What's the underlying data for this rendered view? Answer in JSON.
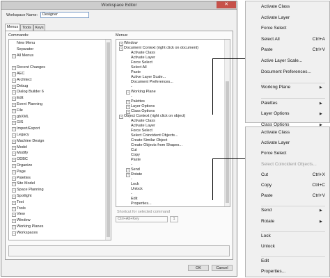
{
  "dialog": {
    "title": "Workspace Editor",
    "close_glyph": "✕",
    "workspace_name_label": "Workspace Name:",
    "workspace_name_value": "Designer",
    "tabs": [
      "Menus",
      "Tools",
      "Keys"
    ],
    "commands_label": "Commands:",
    "menus_label": "Menus:",
    "commands": [
      {
        "label": "New Menu",
        "exp": false
      },
      {
        "label": "Separator",
        "exp": false
      },
      {
        "label": "All Menus",
        "exp": true
      },
      {
        "label": "",
        "exp": false
      },
      {
        "label": "Recent Changes",
        "exp": true
      },
      {
        "label": "AEC",
        "exp": true
      },
      {
        "label": "Architect",
        "exp": true
      },
      {
        "label": "Debug",
        "exp": true
      },
      {
        "label": "Dialog Builder 6",
        "exp": true
      },
      {
        "label": "Edit",
        "exp": true
      },
      {
        "label": "Event Planning",
        "exp": true
      },
      {
        "label": "File",
        "exp": true
      },
      {
        "label": "gbXML",
        "exp": true
      },
      {
        "label": "GIS",
        "exp": true
      },
      {
        "label": "Import/Export",
        "exp": true
      },
      {
        "label": "Legacy",
        "exp": true
      },
      {
        "label": "Machine Design",
        "exp": true
      },
      {
        "label": "Model",
        "exp": true
      },
      {
        "label": "Modify",
        "exp": true
      },
      {
        "label": "ODBC",
        "exp": true
      },
      {
        "label": "Organize",
        "exp": true
      },
      {
        "label": "Page",
        "exp": true
      },
      {
        "label": "Palettes",
        "exp": true
      },
      {
        "label": "Site Model",
        "exp": true
      },
      {
        "label": "Space Planning",
        "exp": true
      },
      {
        "label": "Spotlight",
        "exp": true
      },
      {
        "label": "Text",
        "exp": true
      },
      {
        "label": "Tools",
        "exp": true
      },
      {
        "label": "View",
        "exp": true
      },
      {
        "label": "Window",
        "exp": true
      },
      {
        "label": "Working Planes",
        "exp": true
      },
      {
        "label": "Workspaces",
        "exp": true
      }
    ],
    "menus_tree": [
      {
        "label": "Window",
        "level": 0,
        "exp": true
      },
      {
        "label": "Document Context (right click on document)",
        "level": 0,
        "exp": true
      },
      {
        "label": "Activate Class",
        "level": 1,
        "exp": false
      },
      {
        "label": "Activate Layer",
        "level": 1,
        "exp": false
      },
      {
        "label": "Force Select",
        "level": 1,
        "exp": false
      },
      {
        "label": "Select All",
        "level": 1,
        "exp": false
      },
      {
        "label": "Paste",
        "level": 1,
        "exp": false
      },
      {
        "label": "Active Layer Scale...",
        "level": 1,
        "exp": false
      },
      {
        "label": "Document Preferences...",
        "level": 1,
        "exp": false
      },
      {
        "label": "-",
        "level": 1,
        "exp": false
      },
      {
        "label": "Working Plane",
        "level": 1,
        "exp": true
      },
      {
        "label": "-",
        "level": 1,
        "exp": false
      },
      {
        "label": "Palettes",
        "level": 1,
        "exp": true
      },
      {
        "label": "Layer Options",
        "level": 1,
        "exp": true
      },
      {
        "label": "Class Options",
        "level": 1,
        "exp": true
      },
      {
        "label": "Object Context (right click on object)",
        "level": 0,
        "exp": true
      },
      {
        "label": "Activate Class",
        "level": 1,
        "exp": false
      },
      {
        "label": "Activate Layer",
        "level": 1,
        "exp": false
      },
      {
        "label": "Force Select",
        "level": 1,
        "exp": false
      },
      {
        "label": "Select Coincident Objects...",
        "level": 1,
        "exp": false
      },
      {
        "label": "Create Similar Object",
        "level": 1,
        "exp": false
      },
      {
        "label": "Create Objects from Shapes...",
        "level": 1,
        "exp": false
      },
      {
        "label": "Cut",
        "level": 1,
        "exp": false
      },
      {
        "label": "Copy",
        "level": 1,
        "exp": false
      },
      {
        "label": "Paste",
        "level": 1,
        "exp": false
      },
      {
        "label": "-",
        "level": 1,
        "exp": false
      },
      {
        "label": "Send",
        "level": 1,
        "exp": true
      },
      {
        "label": "Rotate",
        "level": 1,
        "exp": true
      },
      {
        "label": "-",
        "level": 1,
        "exp": false
      },
      {
        "label": "Lock",
        "level": 1,
        "exp": false
      },
      {
        "label": "Unlock",
        "level": 1,
        "exp": false
      },
      {
        "label": "-",
        "level": 1,
        "exp": false
      },
      {
        "label": "Edit",
        "level": 1,
        "exp": false
      },
      {
        "label": "Properties...",
        "level": 1,
        "exp": false
      }
    ],
    "shortcut_label": "Shortcut for selected command",
    "shortcut_modifier": "Ctrl+Alt+Key",
    "shortcut_key": "1",
    "ok_label": "OK",
    "cancel_label": "Cancel"
  },
  "menu_document": [
    {
      "label": "Activate Class",
      "shortcut": "",
      "submenu": false
    },
    {
      "label": "Activate Layer",
      "shortcut": "",
      "submenu": false
    },
    {
      "label": "Force Select",
      "shortcut": "",
      "submenu": false
    },
    {
      "label": "Select All",
      "shortcut": "Ctrl+A",
      "submenu": false
    },
    {
      "label": "Paste",
      "shortcut": "Ctrl+V",
      "submenu": false
    },
    {
      "label": "Active Layer Scale...",
      "shortcut": "",
      "submenu": false
    },
    {
      "label": "Document Preferences...",
      "shortcut": "",
      "submenu": false
    },
    {
      "label": "-",
      "shortcut": "",
      "submenu": false
    },
    {
      "label": "Working Plane",
      "shortcut": "",
      "submenu": true
    },
    {
      "label": "-",
      "shortcut": "",
      "submenu": false
    },
    {
      "label": "Palettes",
      "shortcut": "",
      "submenu": true
    },
    {
      "label": "Layer Options",
      "shortcut": "",
      "submenu": true
    },
    {
      "label": "Class Options",
      "shortcut": "",
      "submenu": true
    }
  ],
  "menu_object": [
    {
      "label": "Activate Class",
      "shortcut": "",
      "submenu": false,
      "disabled": false
    },
    {
      "label": "Activate Layer",
      "shortcut": "",
      "submenu": false,
      "disabled": false
    },
    {
      "label": "Force Select",
      "shortcut": "",
      "submenu": false,
      "disabled": false
    },
    {
      "label": "Select Coincident Objects...",
      "shortcut": "",
      "submenu": false,
      "disabled": true
    },
    {
      "label": "Cut",
      "shortcut": "Ctrl+X",
      "submenu": false,
      "disabled": false
    },
    {
      "label": "Copy",
      "shortcut": "Ctrl+C",
      "submenu": false,
      "disabled": false
    },
    {
      "label": "Paste",
      "shortcut": "Ctrl+V",
      "submenu": false,
      "disabled": false
    },
    {
      "label": "-",
      "shortcut": "",
      "submenu": false,
      "disabled": false
    },
    {
      "label": "Send",
      "shortcut": "",
      "submenu": true,
      "disabled": false
    },
    {
      "label": "Rotate",
      "shortcut": "",
      "submenu": true,
      "disabled": false
    },
    {
      "label": "-",
      "shortcut": "",
      "submenu": false,
      "disabled": false
    },
    {
      "label": "Lock",
      "shortcut": "",
      "submenu": false,
      "disabled": false
    },
    {
      "label": "Unlock",
      "shortcut": "",
      "submenu": false,
      "disabled": false
    },
    {
      "label": "-",
      "shortcut": "",
      "submenu": false,
      "disabled": false
    },
    {
      "label": "Edit",
      "shortcut": "",
      "submenu": false,
      "disabled": false
    },
    {
      "label": "Properties...",
      "shortcut": "",
      "submenu": false,
      "disabled": false
    }
  ],
  "icons": {
    "expand": "+",
    "submenu_arrow": "▶",
    "close": "close-icon"
  },
  "colors": {
    "close_button": "#c7514a",
    "input_border": "#7a9cc6",
    "menu_bg": "#f0f0f0"
  }
}
